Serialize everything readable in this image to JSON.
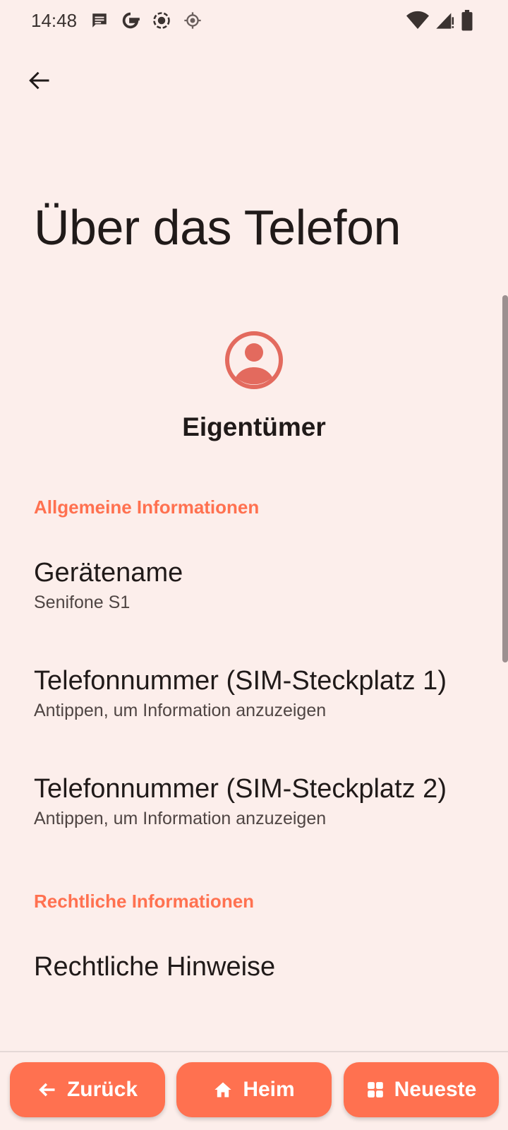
{
  "status_bar": {
    "time": "14:48",
    "left_icons": [
      "message-icon",
      "google-icon",
      "screen-record-icon",
      "location-icon"
    ],
    "right_icons": [
      "wifi-icon",
      "signal-icon",
      "battery-icon"
    ]
  },
  "header": {
    "back_icon": "arrow-back-icon"
  },
  "page": {
    "title": "Über das Telefon",
    "owner_label": "Eigentümer"
  },
  "sections": {
    "general": {
      "header": "Allgemeine Informationen",
      "items": [
        {
          "title": "Gerätename",
          "summary": "Senifone S1"
        },
        {
          "title": "Telefonnummer (SIM-Steckplatz 1)",
          "summary": "Antippen, um Information anzuzeigen"
        },
        {
          "title": "Telefonnummer (SIM-Steckplatz 2)",
          "summary": "Antippen, um Information anzuzeigen"
        }
      ]
    },
    "legal": {
      "header": "Rechtliche Informationen",
      "items": [
        {
          "title": "Rechtliche Hinweise"
        }
      ]
    }
  },
  "nav": {
    "back_label": "Zurück",
    "home_label": "Heim",
    "recent_label": "Neueste"
  },
  "colors": {
    "background": "#FCEEEB",
    "accent": "#FF7150",
    "avatar": "#E36A5E"
  }
}
